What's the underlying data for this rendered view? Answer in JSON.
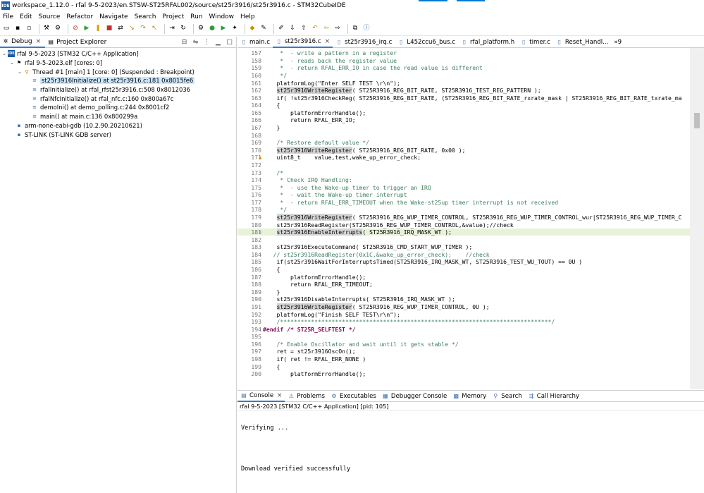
{
  "window": {
    "title": "workspace_1.12.0 - rfal 9-5-2023/en.STSW-ST25RFAL002/source/st25r3916/st25r3916.c - STM32CubeIDE",
    "app_icon": "IDE"
  },
  "menu": [
    "File",
    "Edit",
    "Source",
    "Refactor",
    "Navigate",
    "Search",
    "Project",
    "Run",
    "Window",
    "Help"
  ],
  "left_panel": {
    "tabs": [
      {
        "label": "Debug",
        "icon": "debug-icon"
      },
      {
        "label": "Project Explorer",
        "icon": "project-explorer-icon"
      }
    ],
    "tree": [
      {
        "label": "rfal 9-5-2023 [STM32 C/C++ Application]",
        "indent": 0,
        "twisty": "v",
        "icon": "IDE"
      },
      {
        "label": "rfal 9-5-2023.elf [cores: 0]",
        "indent": 1,
        "twisty": "v",
        "icon": "elf"
      },
      {
        "label": "Thread #1 [main] 1 [core: 0] (Suspended : Breakpoint)",
        "indent": 2,
        "twisty": "v",
        "icon": "thread"
      },
      {
        "label": "st25r3916Initialize() at st25r3916.c:181 0x8015fe6",
        "indent": 3,
        "twisty": "",
        "icon": "frame",
        "selected": true
      },
      {
        "label": "rfalInitialize() at rfal_rfst25r3916.c:508 0x8012036",
        "indent": 3,
        "twisty": "",
        "icon": "frame"
      },
      {
        "label": "rfalNfcInitialize() at rfal_nfc.c:160 0x800a67c",
        "indent": 3,
        "twisty": "",
        "icon": "frame"
      },
      {
        "label": "demoIni() at demo_polling.c:244 0x8001cf2",
        "indent": 3,
        "twisty": "",
        "icon": "frame"
      },
      {
        "label": "main() at main.c:136 0x800299a",
        "indent": 3,
        "twisty": "",
        "icon": "frame"
      },
      {
        "label": "arm-none-eabi-gdb (10.2.90.20210621)",
        "indent": 1,
        "twisty": "",
        "icon": "gdb"
      },
      {
        "label": "ST-LINK (ST-LINK GDB server)",
        "indent": 1,
        "twisty": "",
        "icon": "gdb"
      }
    ]
  },
  "editor": {
    "tabs": [
      {
        "label": "main.c",
        "active": false
      },
      {
        "label": "st25r3916.c",
        "active": true,
        "close": "×"
      },
      {
        "label": "st25r3916_irq.c",
        "active": false
      },
      {
        "label": "L452ccu6_bus.c",
        "active": false
      },
      {
        "label": "rfal_platform.h",
        "active": false
      },
      {
        "label": "timer.c",
        "active": false
      },
      {
        "label": "Reset_Handl...",
        "active": false
      }
    ],
    "overflow": "»9",
    "lines": [
      {
        "n": "157",
        "t": "     *  - write a pattern in a register",
        "c": "cm"
      },
      {
        "n": "158",
        "t": "     *  - reads back the register value",
        "c": "cm"
      },
      {
        "n": "159",
        "t": "     *  - return RFAL_ERR_IO in case the read value is different",
        "c": "cm"
      },
      {
        "n": "160",
        "t": "     */",
        "c": "cm"
      },
      {
        "n": "161",
        "t": "    platformLog(\"Enter SELF TEST \\r\\n\");",
        "c": ""
      },
      {
        "n": "162",
        "t": "    st25r3916WriteRegister( ST25R3916_REG_BIT_RATE, ST25R3916_TEST_REG_PATTERN );",
        "c": "",
        "fn": "st25r3916WriteRegister"
      },
      {
        "n": "163",
        "t": "    if( !st25r3916CheckReg( ST25R3916_REG_BIT_RATE, (ST25R3916_REG_BIT_RATE_rxrate_mask | ST25R3916_REG_BIT_RATE_txrate_ma",
        "c": ""
      },
      {
        "n": "164",
        "t": "    {",
        "c": ""
      },
      {
        "n": "165",
        "t": "        platformErrorHandle();",
        "c": ""
      },
      {
        "n": "166",
        "t": "        return RFAL_ERR_IO;",
        "c": ""
      },
      {
        "n": "167",
        "t": "    }",
        "c": ""
      },
      {
        "n": "168",
        "t": "",
        "c": ""
      },
      {
        "n": "169",
        "t": "    /* Restore default value */",
        "c": "cm"
      },
      {
        "n": "170",
        "t": "    st25r3916WriteRegister( ST25R3916_REG_BIT_RATE, 0x00 );",
        "c": "",
        "fn": "st25r3916WriteRegister"
      },
      {
        "n": "171",
        "t": "    uint8_t    value,test,wake_up_error_check;",
        "c": "",
        "warn": true
      },
      {
        "n": "172",
        "t": "",
        "c": ""
      },
      {
        "n": "173",
        "t": "    /*",
        "c": "cm"
      },
      {
        "n": "174",
        "t": "     * Check IRQ Handling:",
        "c": "cm"
      },
      {
        "n": "175",
        "t": "     *  - use the Wake-up timer to trigger an IRQ",
        "c": "cm"
      },
      {
        "n": "176",
        "t": "     *  - wait the Wake-up timer interrupt",
        "c": "cm"
      },
      {
        "n": "177",
        "t": "     *  - return RFAL_ERR_TIMEOUT when the Wake-st25up timer interrupt is not received",
        "c": "cm"
      },
      {
        "n": "178",
        "t": "     */",
        "c": "cm"
      },
      {
        "n": "179",
        "t": "    st25r3916WriteRegister( ST25R3916_REG_WUP_TIMER_CONTROL, ST25R3916_REG_WUP_TIMER_CONTROL_wur|ST25R3916_REG_WUP_TIMER_C",
        "c": "",
        "fn": "st25r3916WriteRegister"
      },
      {
        "n": "180",
        "t": "    st25r3916ReadRegister(ST25R3916_REG_WUP_TIMER_CONTROL,&value);//check",
        "c": ""
      },
      {
        "n": "181",
        "t": "    st25r3916EnableInterrupts( ST25R3916_IRQ_MASK_WT );",
        "c": "",
        "hl": true,
        "fn": "st25r3916EnableInterrupts"
      },
      {
        "n": "182",
        "t": "",
        "c": ""
      },
      {
        "n": "183",
        "t": "    st25r3916ExecuteCommand( ST25R3916_CMD_START_WUP_TIMER );",
        "c": ""
      },
      {
        "n": "184",
        "t": "   // st25r3916ReadRegister(0x1C,&wake_up_error_check);    //check",
        "c": "cm"
      },
      {
        "n": "185",
        "t": "    if(st25r3916WaitForInterruptsTimed(ST25R3916_IRQ_MASK_WT, ST25R3916_TEST_WU_TOUT) == 0U )",
        "c": ""
      },
      {
        "n": "186",
        "t": "    {",
        "c": ""
      },
      {
        "n": "187",
        "t": "        platformErrorHandle();",
        "c": ""
      },
      {
        "n": "188",
        "t": "        return RFAL_ERR_TIMEOUT;",
        "c": ""
      },
      {
        "n": "189",
        "t": "    }",
        "c": ""
      },
      {
        "n": "190",
        "t": "    st25r3916DisableInterrupts( ST25R3916_IRQ_MASK_WT );",
        "c": ""
      },
      {
        "n": "191",
        "t": "    st25r3916WriteRegister( ST25R3916_REG_WUP_TIMER_CONTROL, 0U );",
        "c": "",
        "fn": "st25r3916WriteRegister"
      },
      {
        "n": "192",
        "t": "    platformLog(\"Finish SELF TEST\\r\\n\");",
        "c": ""
      },
      {
        "n": "193",
        "t": "    /*******************************************************************************/",
        "c": "cm"
      },
      {
        "n": "194",
        "t": "#endif /* ST25R_SELFTEST */",
        "c": "pp"
      },
      {
        "n": "195",
        "t": "",
        "c": ""
      },
      {
        "n": "196",
        "t": "    /* Enable Oscillator and wait until it gets stable */",
        "c": "cm"
      },
      {
        "n": "197",
        "t": "    ret = st25r3916OscOn();",
        "c": ""
      },
      {
        "n": "198",
        "t": "    if( ret != RFAL_ERR_NONE )",
        "c": ""
      },
      {
        "n": "199",
        "t": "    {",
        "c": ""
      },
      {
        "n": "200",
        "t": "        platformErrorHandle();",
        "c": ""
      }
    ]
  },
  "console": {
    "tabs": [
      {
        "label": "Console",
        "active": true,
        "close": "×"
      },
      {
        "label": "Problems"
      },
      {
        "label": "Executables"
      },
      {
        "label": "Debugger Console"
      },
      {
        "label": "Memory"
      },
      {
        "label": "Search"
      },
      {
        "label": "Call Hierarchy"
      }
    ],
    "status": "rfal 9-5-2023 [STM32 C/C++ Application]  [pid: 105]",
    "output": [
      "Verifying ...",
      "Download verified successfully"
    ]
  }
}
